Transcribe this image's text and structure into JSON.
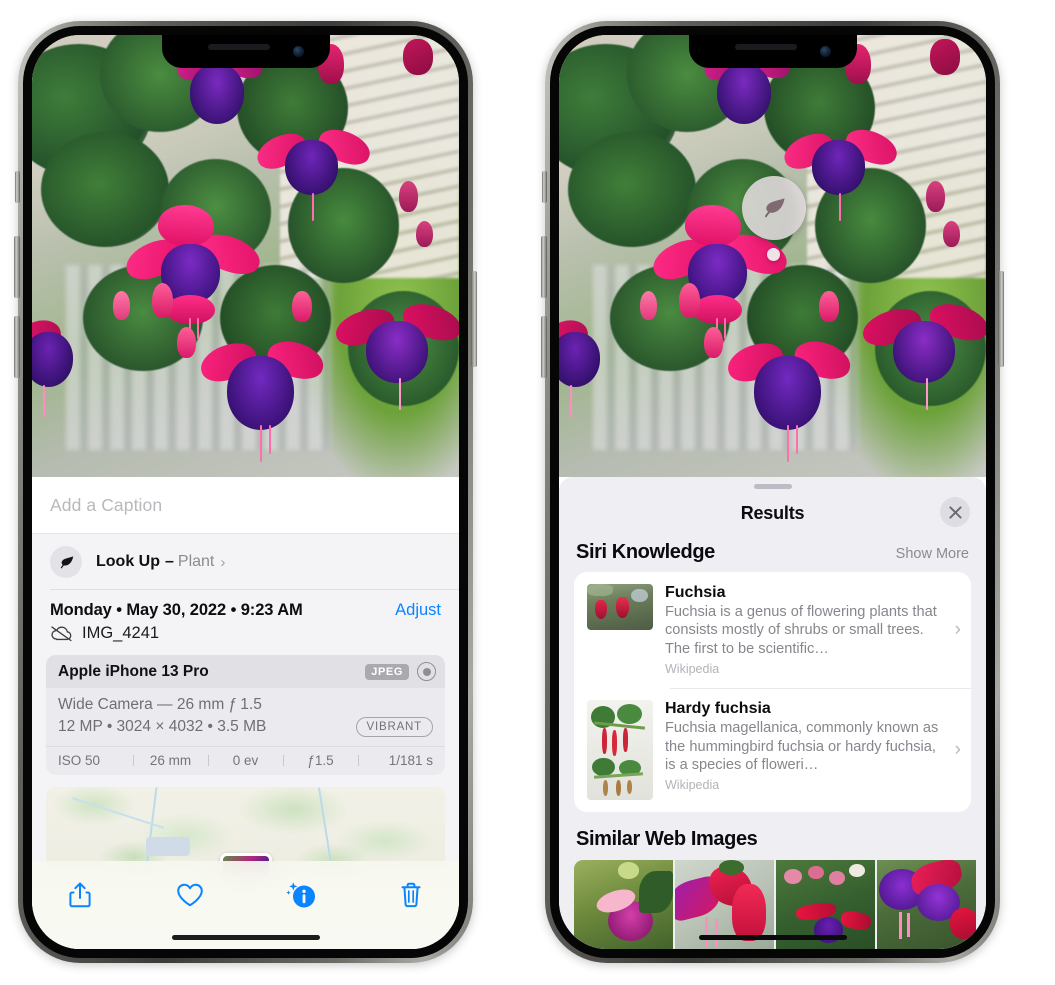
{
  "left_phone": {
    "name": "iphone-photos-info-view",
    "photo": {
      "alt_name": "fuchsia-flowers-photo"
    },
    "caption_field": {
      "placeholder": "Add a Caption",
      "value": ""
    },
    "look_up": {
      "icon": "leaf-icon",
      "title": "Look Up",
      "dash": "–",
      "subject": "Plant",
      "chevron": "›"
    },
    "meta": {
      "date": "Monday • May 30, 2022 • 9:23 AM",
      "adjust_label": "Adjust",
      "cloud_icon": "cloud-slash-icon",
      "file_name": "IMG_4241"
    },
    "camera_card": {
      "model": "Apple iPhone 13 Pro",
      "format_badge": "JPEG",
      "hdr_icon": "hdr-circle-icon",
      "lens_line": "Wide Camera — 26 mm ƒ 1.5",
      "size_line": "12 MP • 3024 × 4032 • 3.5 MB",
      "style_badge": "VIBRANT",
      "exif": [
        "ISO 50",
        "26 mm",
        "0 ev",
        "ƒ1.5",
        "1/181 s"
      ]
    },
    "map": {
      "name": "location-map-preview",
      "thumb_name": "map-photo-thumbnail"
    },
    "toolbar": [
      {
        "name": "share-button",
        "icon": "share-icon"
      },
      {
        "name": "favorite-button",
        "icon": "heart-icon"
      },
      {
        "name": "info-button",
        "icon": "info-sparkle-icon"
      },
      {
        "name": "delete-button",
        "icon": "trash-icon"
      }
    ],
    "accent_color": "#0a84ff"
  },
  "right_phone": {
    "name": "iphone-visual-look-up-results",
    "badge": {
      "icon": "leaf-icon",
      "name": "visual-look-up-badge"
    },
    "sheet": {
      "title": "Results",
      "close_icon": "close-icon",
      "sections": [
        {
          "title": "Siri Knowledge",
          "action": "Show More",
          "items": [
            {
              "title": "Fuchsia",
              "description": "Fuchsia is a genus of flowering plants that consists mostly of shrubs or small trees. The first to be scientific…",
              "source": "Wikipedia",
              "chevron": "›",
              "thumb_name": "fuchsia-thumbnail"
            },
            {
              "title": "Hardy fuchsia",
              "description": "Fuchsia magellanica, commonly known as the hummingbird fuchsia or hardy fuchsia, is a species of floweri…",
              "source": "Wikipedia",
              "chevron": "›",
              "thumb_name": "hardy-fuchsia-thumbnail"
            }
          ]
        },
        {
          "title": "Similar Web Images",
          "thumbs": [
            "similar-image-1",
            "similar-image-2",
            "similar-image-3",
            "similar-image-4"
          ]
        }
      ]
    }
  }
}
